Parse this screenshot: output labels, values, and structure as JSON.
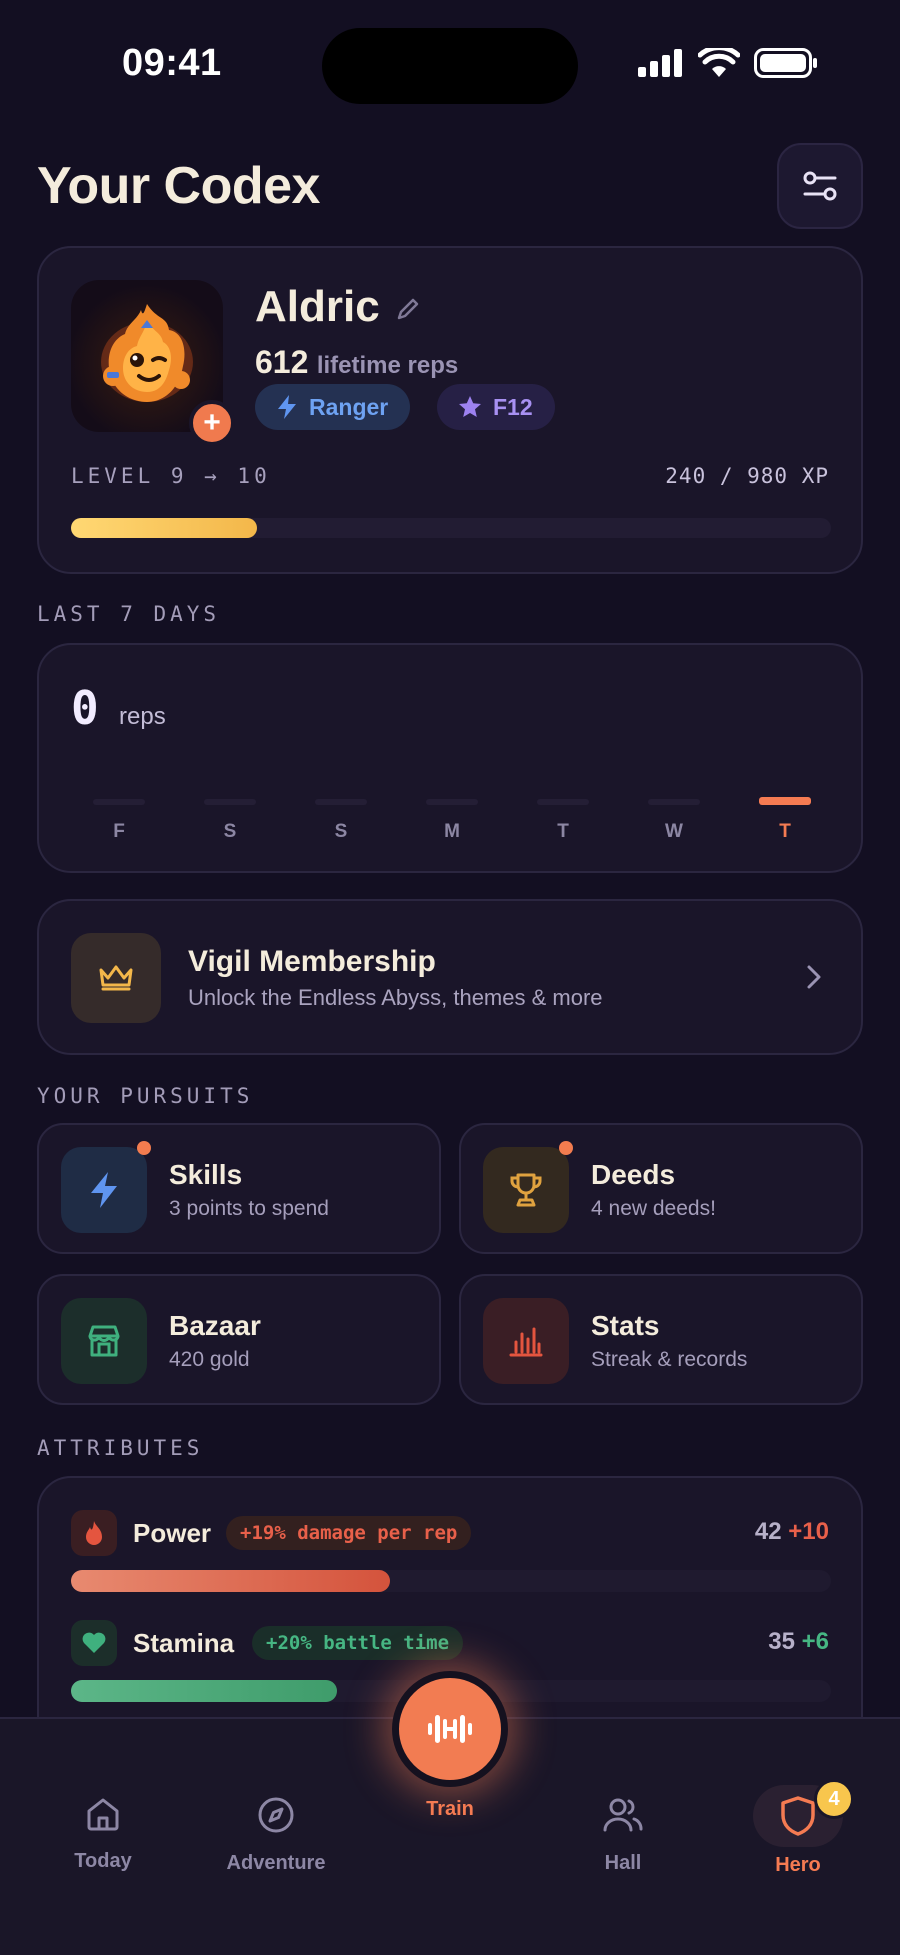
{
  "status_bar": {
    "time": "09:41"
  },
  "header": {
    "title": "Your Codex"
  },
  "profile": {
    "name": "Aldric",
    "reps": "612",
    "reps_label": "lifetime reps",
    "class_chip": "Ranger",
    "rank_chip": "F12",
    "level_text": "LEVEL 9 → 10",
    "xp_text": "240 / 980 XP",
    "xp_current": 240,
    "xp_max": 980,
    "avatar_add": "+"
  },
  "week": {
    "section_label": "LAST 7 DAYS",
    "total": "0",
    "unit": "reps",
    "days": [
      "F",
      "S",
      "S",
      "M",
      "T",
      "W",
      "T"
    ],
    "active_index": 6
  },
  "membership": {
    "title": "Vigil Membership",
    "subtitle": "Unlock the Endless Abyss, themes & more"
  },
  "pursuits": {
    "section_label": "YOUR PURSUITS",
    "items": [
      {
        "title": "Skills",
        "subtitle": "3 points to spend",
        "icon": "lightning-icon",
        "dot": true
      },
      {
        "title": "Deeds",
        "subtitle": "4 new deeds!",
        "icon": "trophy-icon",
        "dot": true
      },
      {
        "title": "Bazaar",
        "subtitle": "420 gold",
        "icon": "shop-icon",
        "dot": false
      },
      {
        "title": "Stats",
        "subtitle": "Streak & records",
        "icon": "bar-chart-icon",
        "dot": false
      }
    ]
  },
  "attributes": {
    "section_label": "ATTRIBUTES",
    "items": [
      {
        "name": "Power",
        "badge": "+19% damage per rep",
        "value": "42",
        "bonus": "+10",
        "fill": 0.42,
        "icon": "flame-icon"
      },
      {
        "name": "Stamina",
        "badge": "+20% battle time",
        "value": "35",
        "bonus": "+6",
        "fill": 0.35,
        "icon": "heart-icon"
      }
    ]
  },
  "tabs": {
    "today": "Today",
    "adventure": "Adventure",
    "train": "Train",
    "hall": "Hall",
    "hero": "Hero",
    "hero_badge": "4"
  },
  "colors": {
    "accent": "#f57b52",
    "xp": "#ffd873",
    "power": "#e0664a",
    "stamina": "#4fa777",
    "background": "#130f22"
  }
}
